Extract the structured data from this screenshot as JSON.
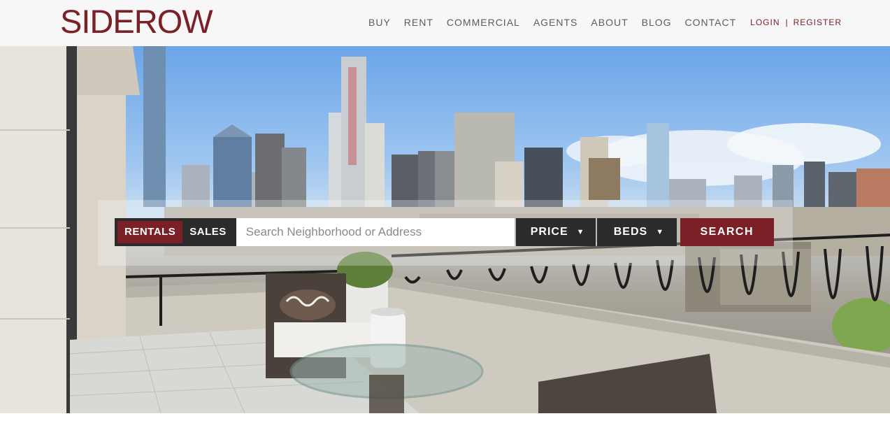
{
  "brand": {
    "name": "SIDEROW",
    "color": "#7b2027"
  },
  "nav": {
    "items": [
      "BUY",
      "RENT",
      "COMMERCIAL",
      "AGENTS",
      "ABOUT",
      "BLOG",
      "CONTACT"
    ],
    "login": "LOGIN",
    "separator": "|",
    "register": "REGISTER"
  },
  "search": {
    "tabs": {
      "rentals": "RENTALS",
      "sales": "SALES"
    },
    "active_tab": "RENTALS",
    "placeholder": "Search Neighborhood or Address",
    "value": "",
    "price_label": "PRICE",
    "beds_label": "BEDS",
    "caret": "▼",
    "button_label": "SEARCH"
  },
  "colors": {
    "accent": "#7b2027",
    "dark": "#2b2b2b",
    "header_bg": "#f7f7f7"
  }
}
